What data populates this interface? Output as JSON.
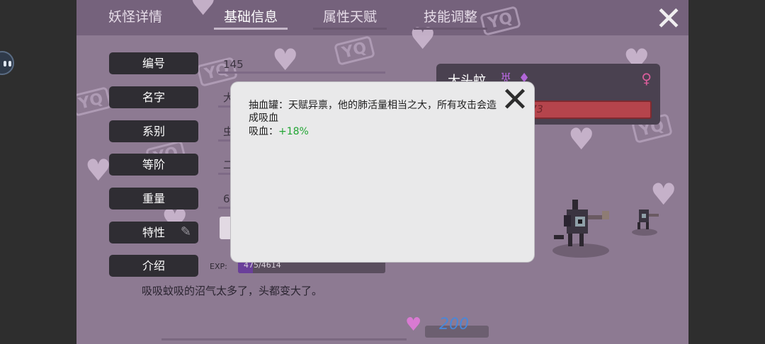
{
  "tabs": [
    {
      "label": "妖怪详情"
    },
    {
      "label": "基础信息"
    },
    {
      "label": "属性天赋"
    },
    {
      "label": "技能调整"
    }
  ],
  "active_tab": "基础信息",
  "fields": {
    "number": {
      "label": "编号",
      "value": "145"
    },
    "name": {
      "label": "名字",
      "value": "大"
    },
    "series": {
      "label": "系别",
      "value": "虫"
    },
    "rank": {
      "label": "等阶",
      "value": "二"
    },
    "weight": {
      "label": "重量",
      "value": "6("
    },
    "trait": {
      "label": "特性"
    },
    "intro": {
      "label": "介绍"
    }
  },
  "exp": {
    "label": "EXP:",
    "text": "475/4614",
    "current": 475,
    "max": 4614
  },
  "description": "吸吸蚊吸的沼气太多了，头都变大了。",
  "monster": {
    "name": "大头蚊",
    "hp_text": "773"
  },
  "stamina": {
    "value": "200"
  },
  "popup": {
    "text": "抽血罐：天赋异禀，他的肺活量相当之大，所有攻击会造成吸血",
    "stat_label": "吸血：",
    "stat_value": "+18%"
  },
  "watermark": "YQ",
  "colors": {
    "background": "#8d7a92",
    "label_button": "#2f2d33",
    "hp_bar": "#b5444c",
    "exp_fill": "#6a3f9a",
    "buff_text": "#22a534",
    "stamina_text": "#4a87d8"
  },
  "icons": [
    "close-icon",
    "pencil-icon",
    "heart-icon",
    "female-icon"
  ]
}
